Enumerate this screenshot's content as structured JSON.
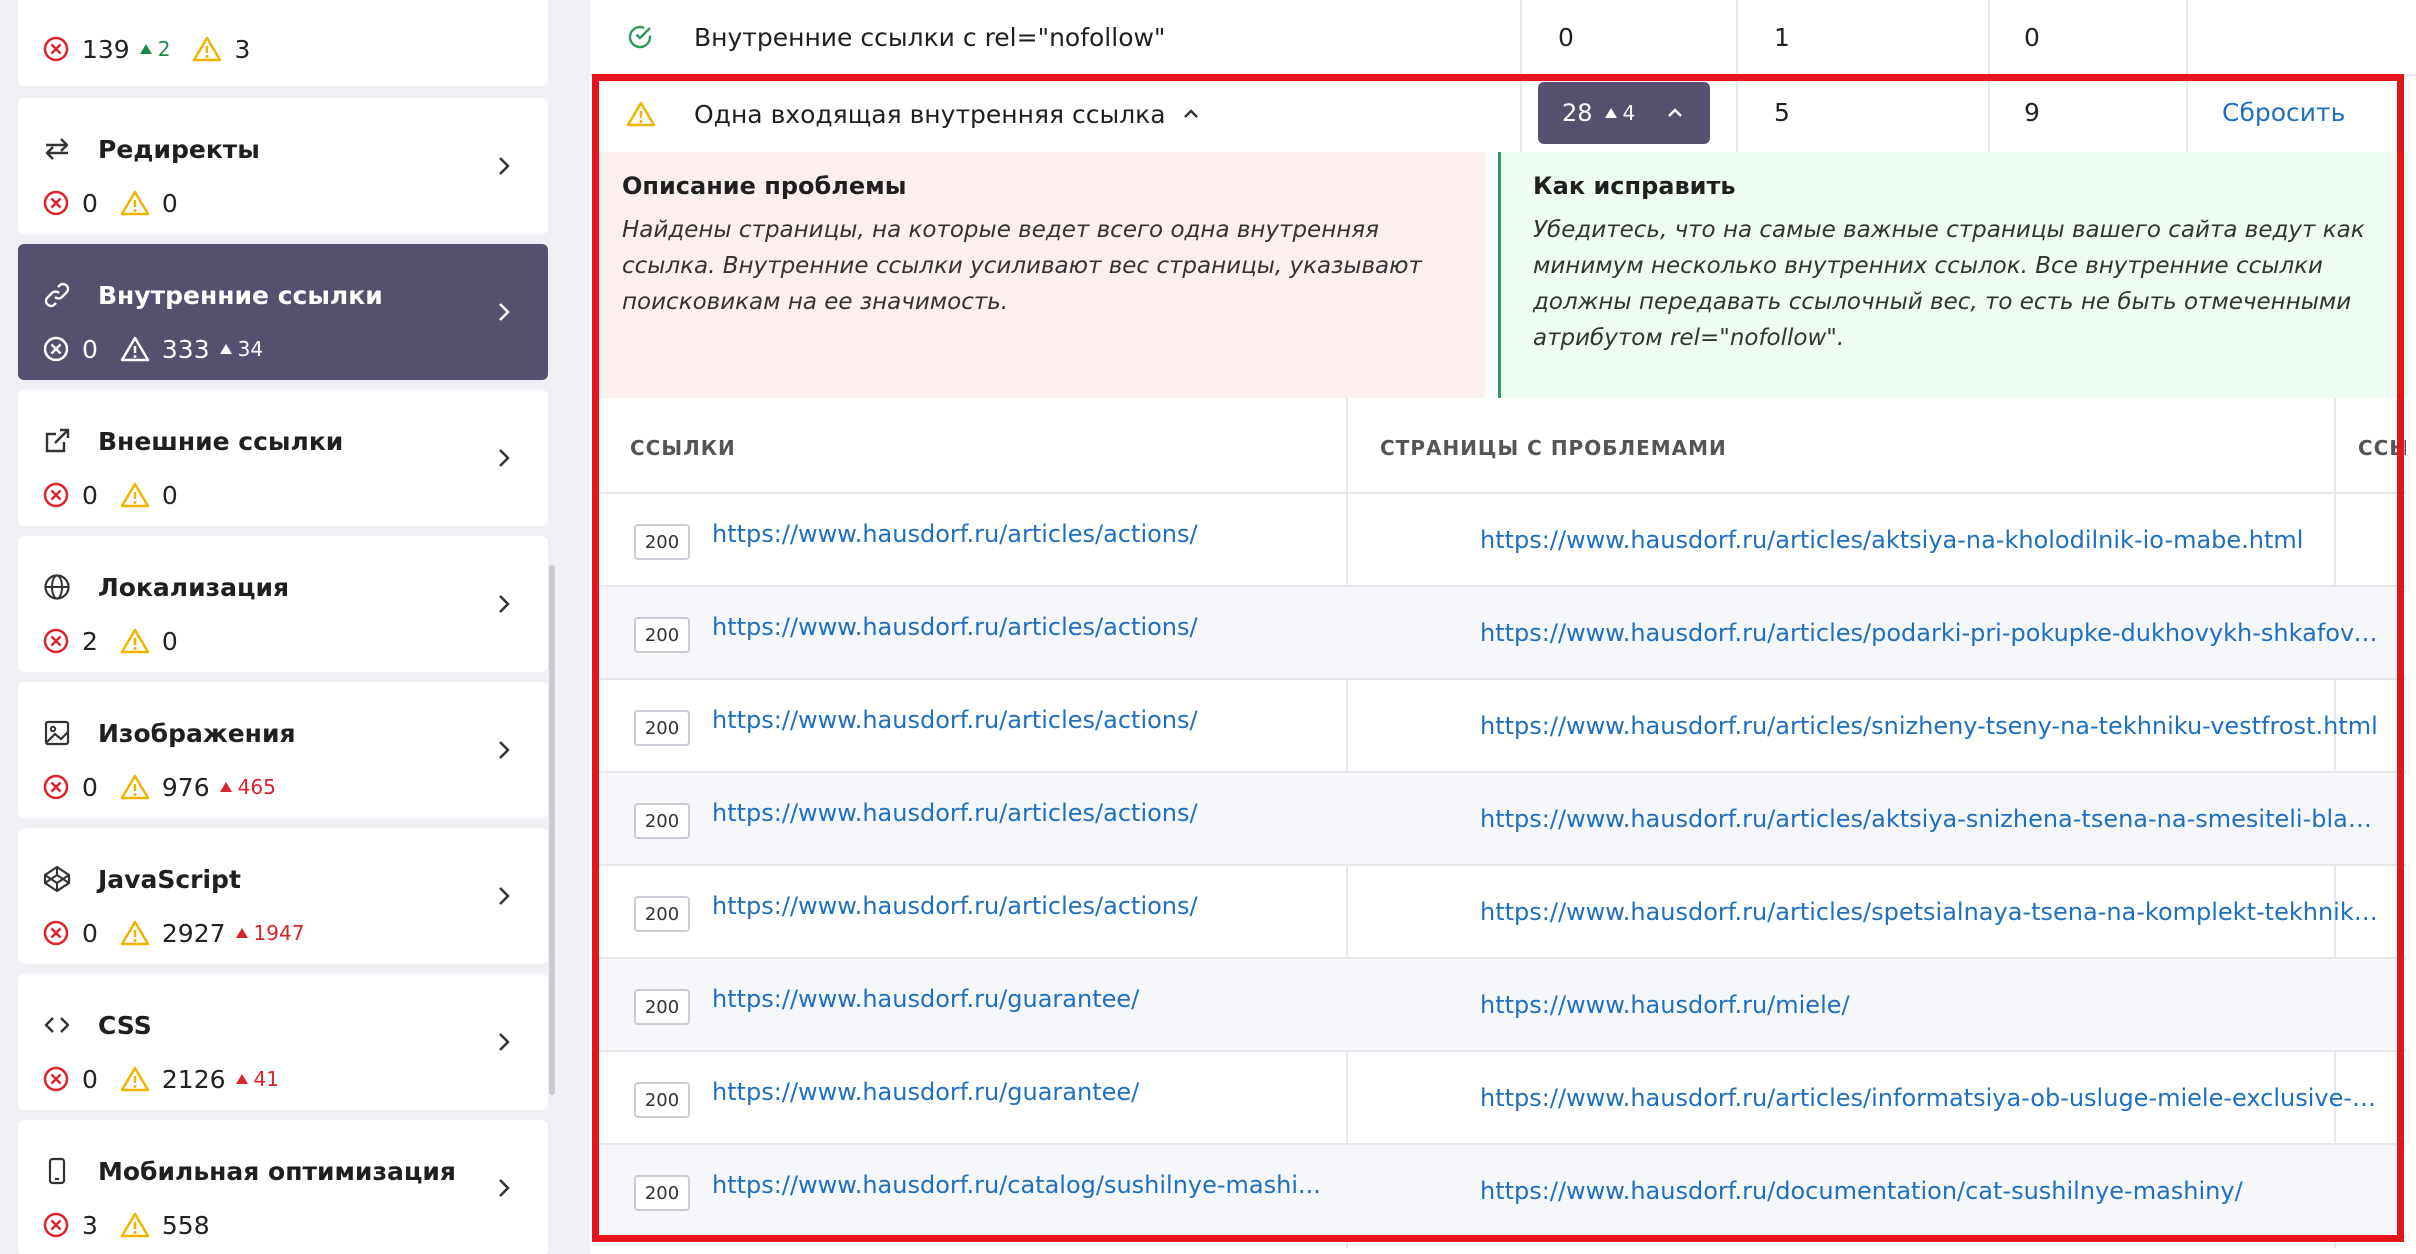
{
  "sidebar": {
    "top_partial": {
      "errors": "139",
      "errors_delta": "2",
      "warnings": "3"
    },
    "items": [
      {
        "title": "Редиректы",
        "icon": "redirect-icon",
        "errors": "0",
        "warnings": "0",
        "warnings_delta": ""
      },
      {
        "title": "Внутренние ссылки",
        "icon": "link-icon",
        "errors": "0",
        "warnings": "333",
        "warnings_delta": "34",
        "active": true
      },
      {
        "title": "Внешние ссылки",
        "icon": "external-link-icon",
        "errors": "0",
        "warnings": "0",
        "warnings_delta": ""
      },
      {
        "title": "Локализация",
        "icon": "globe-icon",
        "errors": "2",
        "warnings": "0",
        "warnings_delta": ""
      },
      {
        "title": "Изображения",
        "icon": "image-icon",
        "errors": "0",
        "warnings": "976",
        "warnings_delta": "465"
      },
      {
        "title": "JavaScript",
        "icon": "codepen-icon",
        "errors": "0",
        "warnings": "2927",
        "warnings_delta": "1947"
      },
      {
        "title": "CSS",
        "icon": "code-icon",
        "errors": "0",
        "warnings": "2126",
        "warnings_delta": "41"
      },
      {
        "title": "Мобильная оптимизация",
        "icon": "mobile-icon",
        "errors": "3",
        "warnings": "558",
        "warnings_delta": ""
      }
    ]
  },
  "main": {
    "row_nofollow": {
      "label": "Внутренние ссылки с rel=\"nofollow\"",
      "col1": "0",
      "col2": "1",
      "col3": "0"
    },
    "row_single": {
      "label": "Одна входящая внутренняя ссылка",
      "count": "28",
      "count_delta": "4",
      "col2": "5",
      "col3": "9",
      "reset": "Сбросить"
    },
    "problem": {
      "title": "Описание проблемы",
      "text": "Найдены страницы, на которые ведет всего одна внутренняя ссылка. Внутренние ссылки усиливают вес страницы, указывают поисковикам на ее значимость."
    },
    "fix": {
      "title": "Как исправить",
      "text": "Убедитесь, что на самые важные страницы вашего сайта ведут как минимум несколько внутренних ссылок. Все внутренние ссылки должны передавать ссылочный вес, то есть не быть отмеченными атрибутом rel=\"nofollow\"."
    },
    "table": {
      "headers": [
        "ССЫЛКИ",
        "СТРАНИЦЫ С ПРОБЛЕМАМИ",
        "ССЫ"
      ],
      "rows": [
        {
          "code": "200",
          "link": "https://www.hausdorf.ru/articles/actions/",
          "page": "https://www.hausdorf.ru/articles/aktsiya-na-kholodilnik-io-mabe.html"
        },
        {
          "code": "200",
          "link": "https://www.hausdorf.ru/articles/actions/",
          "page": "https://www.hausdorf.ru/articles/podarki-pri-pokupke-dukhovykh-shkafov-..."
        },
        {
          "code": "200",
          "link": "https://www.hausdorf.ru/articles/actions/",
          "page": "https://www.hausdorf.ru/articles/snizheny-tseny-na-tekhniku-vestfrost.html"
        },
        {
          "code": "200",
          "link": "https://www.hausdorf.ru/articles/actions/",
          "page": "https://www.hausdorf.ru/articles/aktsiya-snizhena-tsena-na-smesiteli-blanc..."
        },
        {
          "code": "200",
          "link": "https://www.hausdorf.ru/articles/actions/",
          "page": "https://www.hausdorf.ru/articles/spetsialnaya-tsena-na-komplekt-tekhniki-..."
        },
        {
          "code": "200",
          "link": "https://www.hausdorf.ru/guarantee/",
          "page": "https://www.hausdorf.ru/miele/"
        },
        {
          "code": "200",
          "link": "https://www.hausdorf.ru/guarantee/",
          "page": "https://www.hausdorf.ru/articles/informatsiya-ob-usluge-miele-exclusive-ca..."
        },
        {
          "code": "200",
          "link": "https://www.hausdorf.ru/catalog/sushilnye-mashi...",
          "page": "https://www.hausdorf.ru/documentation/cat-sushilnye-mashiny/"
        }
      ]
    }
  },
  "colors": {
    "accent": "#55506f",
    "link": "#1f6fbf",
    "error": "#d9242e",
    "warning": "#f0b400",
    "success": "#2e9b5a",
    "highlight": "#e8141c"
  }
}
